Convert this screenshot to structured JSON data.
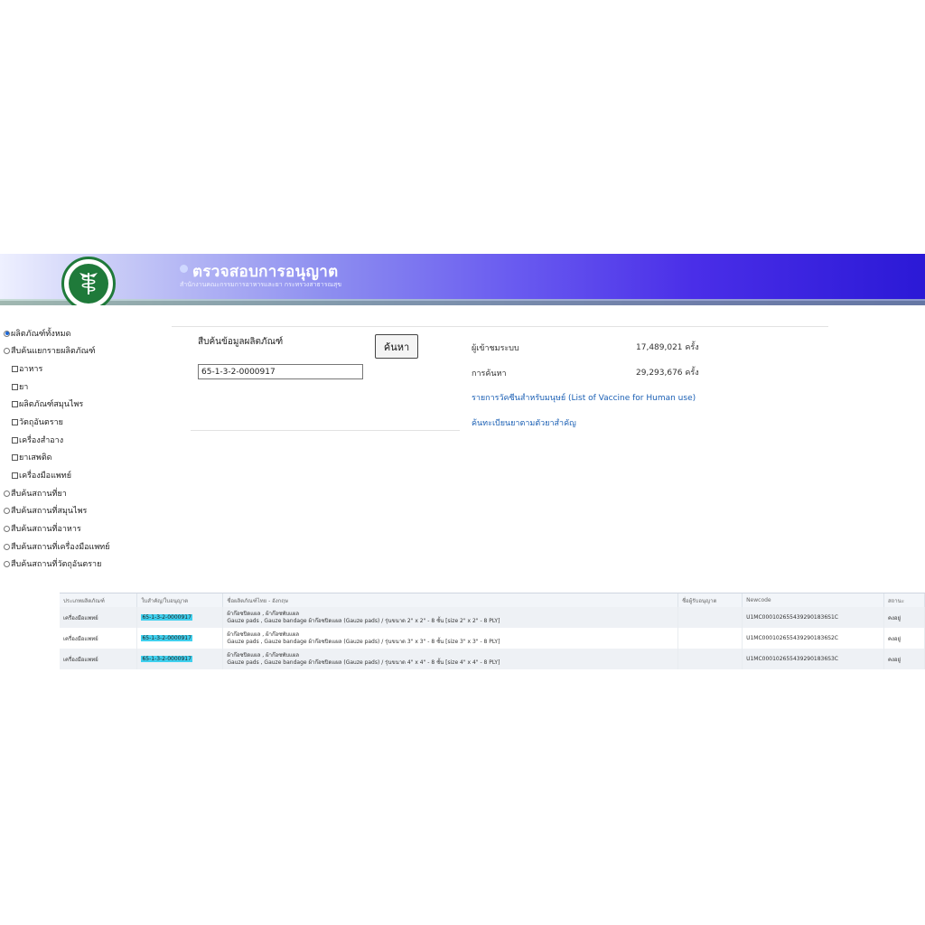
{
  "header": {
    "title": "ตรวจสอบการอนุญาต",
    "subtitle": "สำนักงานคณะกรรมการอาหารและยา กระทรวงสาธารณสุข",
    "colors": {
      "banner_start": "#eef0ff",
      "banner_end": "#2b19d6",
      "logo_green": "#1f7a3a"
    }
  },
  "sidebar": {
    "items": [
      {
        "label": "ผลิตภัณฑ์ทั้งหมด",
        "type": "radio",
        "checked": true
      },
      {
        "label": "สืบค้นแยกรายผลิตภัณฑ์",
        "type": "radio",
        "checked": false
      },
      {
        "label": "อาหาร",
        "type": "checkbox",
        "checked": false
      },
      {
        "label": "ยา",
        "type": "checkbox",
        "checked": false
      },
      {
        "label": "ผลิตภัณฑ์สมุนไพร",
        "type": "checkbox",
        "checked": false
      },
      {
        "label": "วัตถุอันตราย",
        "type": "checkbox",
        "checked": false
      },
      {
        "label": "เครื่องสำอาง",
        "type": "checkbox",
        "checked": false
      },
      {
        "label": "ยาเสพติด",
        "type": "checkbox",
        "checked": false
      },
      {
        "label": "เครื่องมือแพทย์",
        "type": "checkbox",
        "checked": false
      },
      {
        "label": "สืบค้นสถานที่ยา",
        "type": "radio",
        "checked": false
      },
      {
        "label": "สืบค้นสถานที่สมุนไพร",
        "type": "radio",
        "checked": false
      },
      {
        "label": "สืบค้นสถานที่อาหาร",
        "type": "radio",
        "checked": false
      },
      {
        "label": "สืบค้นสถานที่เครื่องมือแพทย์",
        "type": "radio",
        "checked": false
      },
      {
        "label": "สืบค้นสถานที่วัตถุอันตราย",
        "type": "radio",
        "checked": false
      }
    ]
  },
  "search": {
    "label": "สืบค้นข้อมูลผลิตภัณฑ์",
    "button": "ค้นหา",
    "value": "65-1-3-2-0000917"
  },
  "stats": {
    "visitors_label": "ผู้เข้าชมระบบ",
    "visitors_value": "17,489,021 ครั้ง",
    "searches_label": "การค้นหา",
    "searches_value": "29,293,676 ครั้ง"
  },
  "links": {
    "vaccine": "รายการวัคซีนสำหรับมนุษย์ (List of Vaccine for Human use)",
    "drug_register": "ค้นทะเบียนยาตามตัวยาสำคัญ"
  },
  "table": {
    "headers": [
      "ประเภทผลิตภัณฑ์",
      "ใบสำคัญ/ใบอนุญาต",
      "ชื่อผลิตภัณฑ์ไทย - อังกฤษ",
      "ชื่อผู้รับอนุญาต",
      "Newcode",
      "สถานะ"
    ],
    "rows": [
      {
        "type": "เครื่องมือแพทย์",
        "license": "65-1-3-2-0000917",
        "name_th": "ผ้าก๊อซปิดแผล , ผ้าก๊อซพับแผล",
        "name_en": "Gauze pads , Gauze bandage ผ้าก๊อซปิดแผล (Gauze pads) / รุ่นขนาด 2\" x 2\" - 8 ชั้น [size 2\" x 2\" - 8 PLY]",
        "licensee": "",
        "newcode": "U1MC0001026554392901836S1C",
        "status": "คงอยู่"
      },
      {
        "type": "เครื่องมือแพทย์",
        "license": "65-1-3-2-0000917",
        "name_th": "ผ้าก๊อซปิดแผล , ผ้าก๊อซพับแผล",
        "name_en": "Gauze pads , Gauze bandage ผ้าก๊อซปิดแผล (Gauze pads) / รุ่นขนาด 3\" x 3\" - 8 ชั้น [size 3\" x 3\" - 8 PLY]",
        "licensee": "",
        "newcode": "U1MC0001026554392901836S2C",
        "status": "คงอยู่"
      },
      {
        "type": "เครื่องมือแพทย์",
        "license": "65-1-3-2-0000917",
        "name_th": "ผ้าก๊อซปิดแผล , ผ้าก๊อซพับแผล",
        "name_en": "Gauze pads , Gauze bandage ผ้าก๊อซปิดแผล (Gauze pads) / รุ่นขนาด 4\" x 4\" - 8 ชั้น [size 4\" x 4\" - 8 PLY]",
        "licensee": "",
        "newcode": "U1MC0001026554392901836S3C",
        "status": "คงอยู่"
      }
    ]
  }
}
